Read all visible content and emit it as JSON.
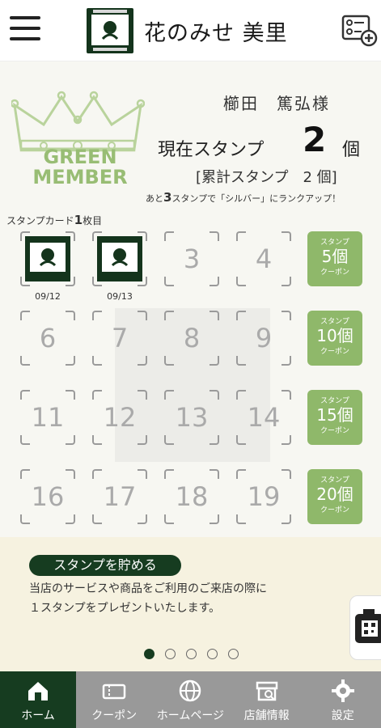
{
  "header": {
    "shop_name": "花のみせ 美里",
    "logo_icon": "floriste-misato-logo",
    "menu_icon": "hamburger-menu-icon",
    "card_add_icon": "member-card-add-icon"
  },
  "member": {
    "rank_line1": "GREEN",
    "rank_line2": "MEMBER",
    "rank_color": "#98bd74",
    "user_name": "櫛田　篤弘様",
    "current_stamp_label": "現在スタンプ",
    "current_stamp_count": "2",
    "current_stamp_unit": "個",
    "total_stamp_text": "[累計スタンプ　2 個]",
    "rankup_prefix": "あと",
    "rankup_number": "3",
    "rankup_suffix": "スタンプで「シルバー」にランクアップ！",
    "card_label_prefix": "スタンプカード",
    "card_label_number": "1",
    "card_label_suffix": "枚目"
  },
  "stamps": [
    {
      "label": "",
      "stamped": true,
      "date": "09/12"
    },
    {
      "label": "",
      "stamped": true,
      "date": "09/13"
    },
    {
      "label": "3",
      "stamped": false
    },
    {
      "label": "4",
      "stamped": false
    },
    {
      "label": "6",
      "stamped": false
    },
    {
      "label": "7",
      "stamped": false
    },
    {
      "label": "8",
      "stamped": false
    },
    {
      "label": "9",
      "stamped": false
    },
    {
      "label": "11",
      "stamped": false
    },
    {
      "label": "12",
      "stamped": false
    },
    {
      "label": "13",
      "stamped": false
    },
    {
      "label": "14",
      "stamped": false
    },
    {
      "label": "16",
      "stamped": false
    },
    {
      "label": "17",
      "stamped": false
    },
    {
      "label": "18",
      "stamped": false
    },
    {
      "label": "19",
      "stamped": false
    }
  ],
  "coupons": [
    {
      "top": "スタンプ",
      "mid": "5個",
      "bot": "クーポン"
    },
    {
      "top": "スタンプ",
      "mid": "10個",
      "bot": "クーポン"
    },
    {
      "top": "スタンプ",
      "mid": "15個",
      "bot": "クーポン"
    },
    {
      "top": "スタンプ",
      "mid": "20個",
      "bot": "クーポン"
    }
  ],
  "info": {
    "title": "スタンプを貯める",
    "line1": "当店のサービスや商品をご利用のご来店の際に",
    "line2": "１スタンプをプレゼントいたします。",
    "camera_icon": "camera-qr-icon",
    "dot_count": 5,
    "active_dot": 0
  },
  "tabs": [
    {
      "label": "ホーム",
      "icon": "home-icon",
      "active": true
    },
    {
      "label": "クーポン",
      "icon": "coupon-icon",
      "active": false
    },
    {
      "label": "ホームページ",
      "icon": "globe-icon",
      "active": false
    },
    {
      "label": "店舗情報",
      "icon": "store-icon",
      "active": false
    },
    {
      "label": "設定",
      "icon": "gear-icon",
      "active": false
    }
  ],
  "colors": {
    "brand_dark_green": "#163c20",
    "coupon_green": "#8fb86a",
    "info_background": "#f6f2e0",
    "tabbar_gray": "#999999"
  }
}
